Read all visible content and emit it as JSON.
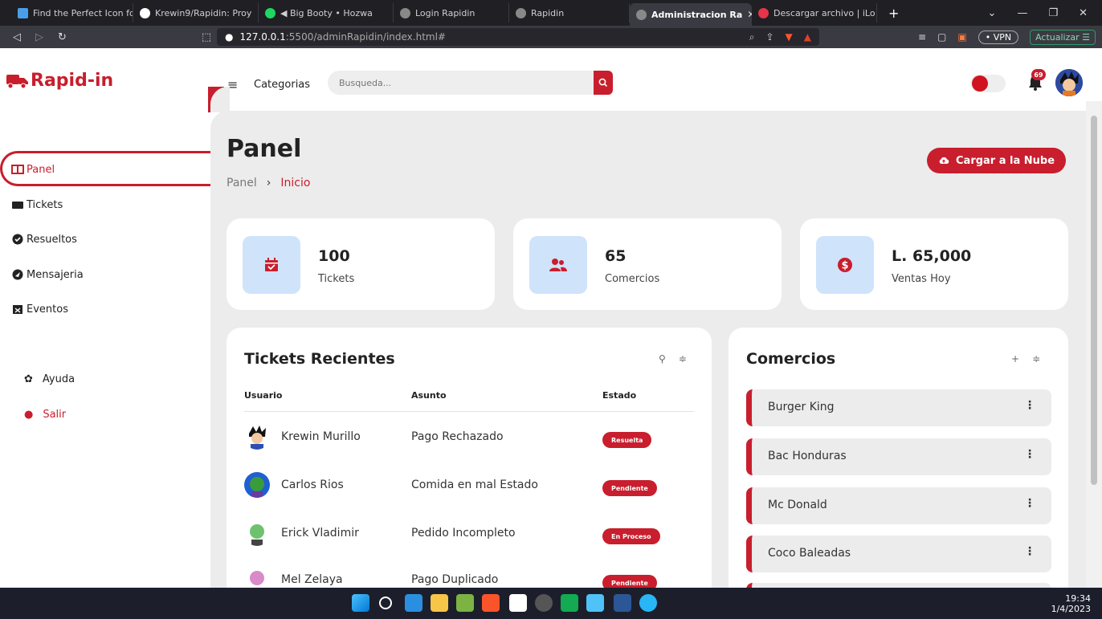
{
  "browser": {
    "tabs": [
      {
        "label": "Find the Perfect Icon fo",
        "color": "#4a9ee8"
      },
      {
        "label": "Krewin9/Rapidin: Proy",
        "color": "#ffffff"
      },
      {
        "label": "◀ Big Booty • Hozwa",
        "color": "#1ed760"
      },
      {
        "label": "Login Rapidin",
        "color": "#cfcfd4"
      },
      {
        "label": "Rapidin",
        "color": "#cfcfd4"
      },
      {
        "label": "Administracion Ra",
        "color": "#cfcfd4"
      },
      {
        "label": "Descargar archivo | iLo",
        "color": "#e8334a"
      }
    ],
    "url_host": "127.0.0.1",
    "url_path": ":5500/adminRapidin/index.html#",
    "vpn_label": "• VPN",
    "update_label": "Actualizar"
  },
  "header": {
    "logo_text": "Rapid-in",
    "categories_label": "Categorias",
    "search_placeholder": "Busqueda...",
    "notifications_count": "69"
  },
  "sidebar": {
    "items": [
      {
        "label": "Panel",
        "icon": "panel-icon"
      },
      {
        "label": "Tickets",
        "icon": "ticket-icon"
      },
      {
        "label": "Resueltos",
        "icon": "check-circle-icon"
      },
      {
        "label": "Mensajeria",
        "icon": "message-icon"
      },
      {
        "label": "Eventos",
        "icon": "calendar-x-icon"
      }
    ],
    "help_label": "Ayuda",
    "logout_label": "Salir"
  },
  "main": {
    "title": "Panel",
    "breadcrumb_root": "Panel",
    "breadcrumb_sep": "›",
    "breadcrumb_current": "Inicio",
    "cloud_button": "Cargar a la Nube",
    "stats": [
      {
        "value": "100",
        "label": "Tickets",
        "icon": "calendar-check-icon"
      },
      {
        "value": "65",
        "label": "Comercios",
        "icon": "users-icon"
      },
      {
        "value": "L. 65,000",
        "label": "Ventas Hoy",
        "icon": "dollar-circle-icon"
      }
    ],
    "tickets_panel": {
      "title": "Tickets Recientes",
      "headers": {
        "user": "Usuario",
        "subject": "Asunto",
        "status": "Estado"
      },
      "rows": [
        {
          "user": "Krewin Murillo",
          "subject": "Pago Rechazado",
          "status": "Resuelta"
        },
        {
          "user": "Carlos Rios",
          "subject": "Comida en mal Estado",
          "status": "Pendiente"
        },
        {
          "user": "Erick Vladimir",
          "subject": "Pedido Incompleto",
          "status": "En Proceso"
        },
        {
          "user": "Mel Zelaya",
          "subject": "Pago Duplicado",
          "status": "Pendiente"
        }
      ]
    },
    "comercios_panel": {
      "title": "Comercios",
      "items": [
        "Burger King",
        "Bac Honduras",
        "Mc Donald",
        "Coco Baleadas"
      ]
    }
  },
  "taskbar": {
    "time": "19:34",
    "date": "1/4/2023"
  },
  "colors": {
    "accent": "#c81e2d",
    "background": "#ececec",
    "stat_icon_bg": "#cfe3fb"
  }
}
